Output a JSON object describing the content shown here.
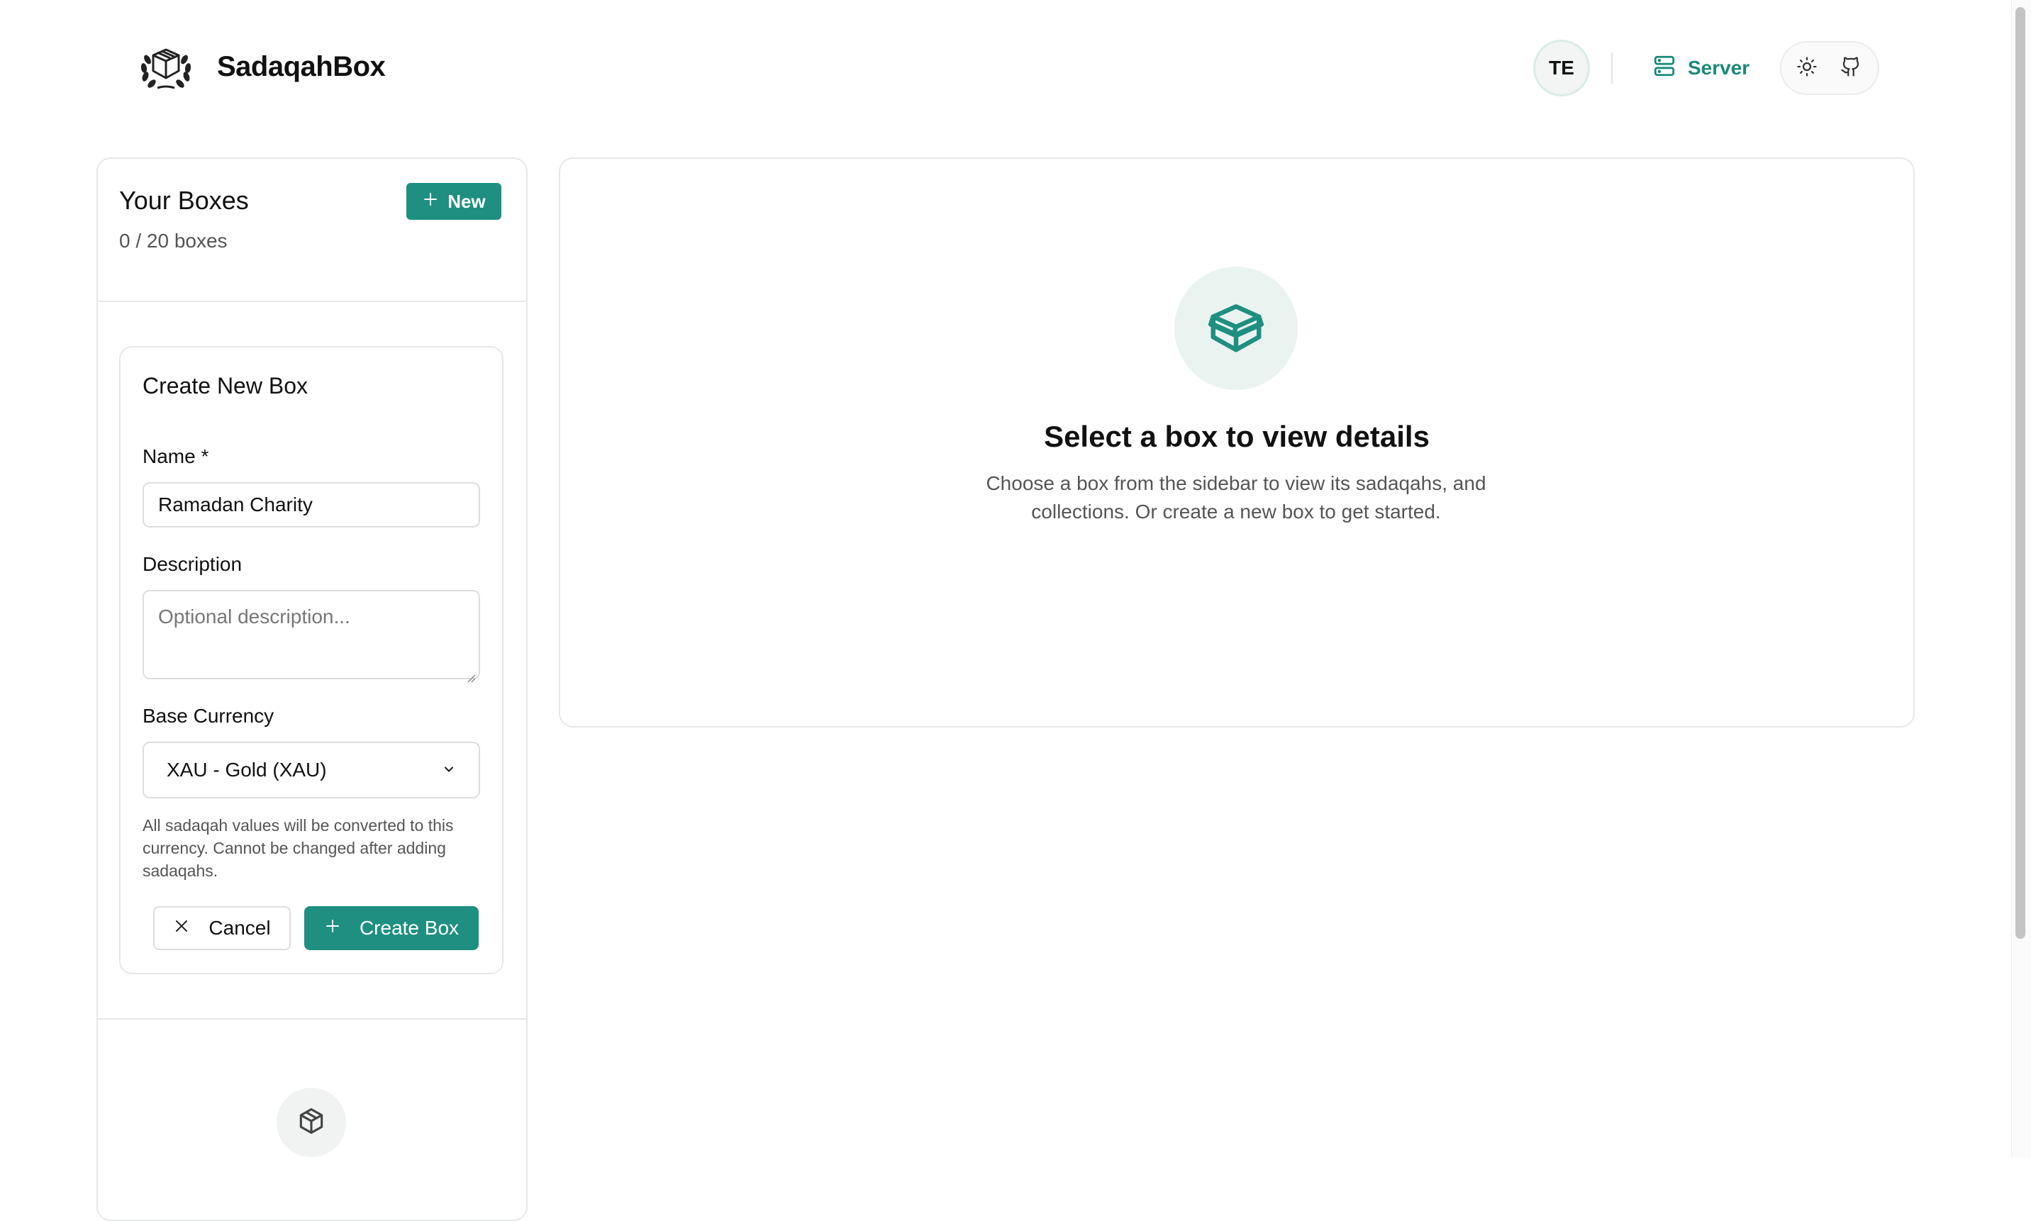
{
  "header": {
    "brand": "SadaqahBox",
    "avatar_initials": "TE",
    "server_label": "Server",
    "logo_icon": "laurel-box-logo",
    "server_icon": "server-icon",
    "theme_icon": "sun-icon",
    "github_icon": "github-icon"
  },
  "sidebar": {
    "title": "Your Boxes",
    "count": "0 / 20 boxes",
    "new_button": "New",
    "empty_icon": "box-icon"
  },
  "form": {
    "title": "Create New Box",
    "name_label": "Name *",
    "name_value": "Ramadan Charity",
    "description_label": "Description",
    "description_placeholder": "Optional description...",
    "currency_label": "Base Currency",
    "currency_selected": "XAU - Gold (XAU)",
    "currency_hint": "All sadaqah values will be converted to this currency. Cannot be changed after adding sadaqahs.",
    "cancel_button": "Cancel",
    "create_button": "Create Box"
  },
  "main": {
    "empty_title": "Select a box to view details",
    "empty_subtitle": "Choose a box from the sidebar to view its sadaqahs, and collections. Or create a new box to get started.",
    "empty_icon": "box-icon"
  },
  "colors": {
    "accent": "#1e8f80",
    "accent_text": "#1a8a7a",
    "border": "#e6e8e7"
  }
}
